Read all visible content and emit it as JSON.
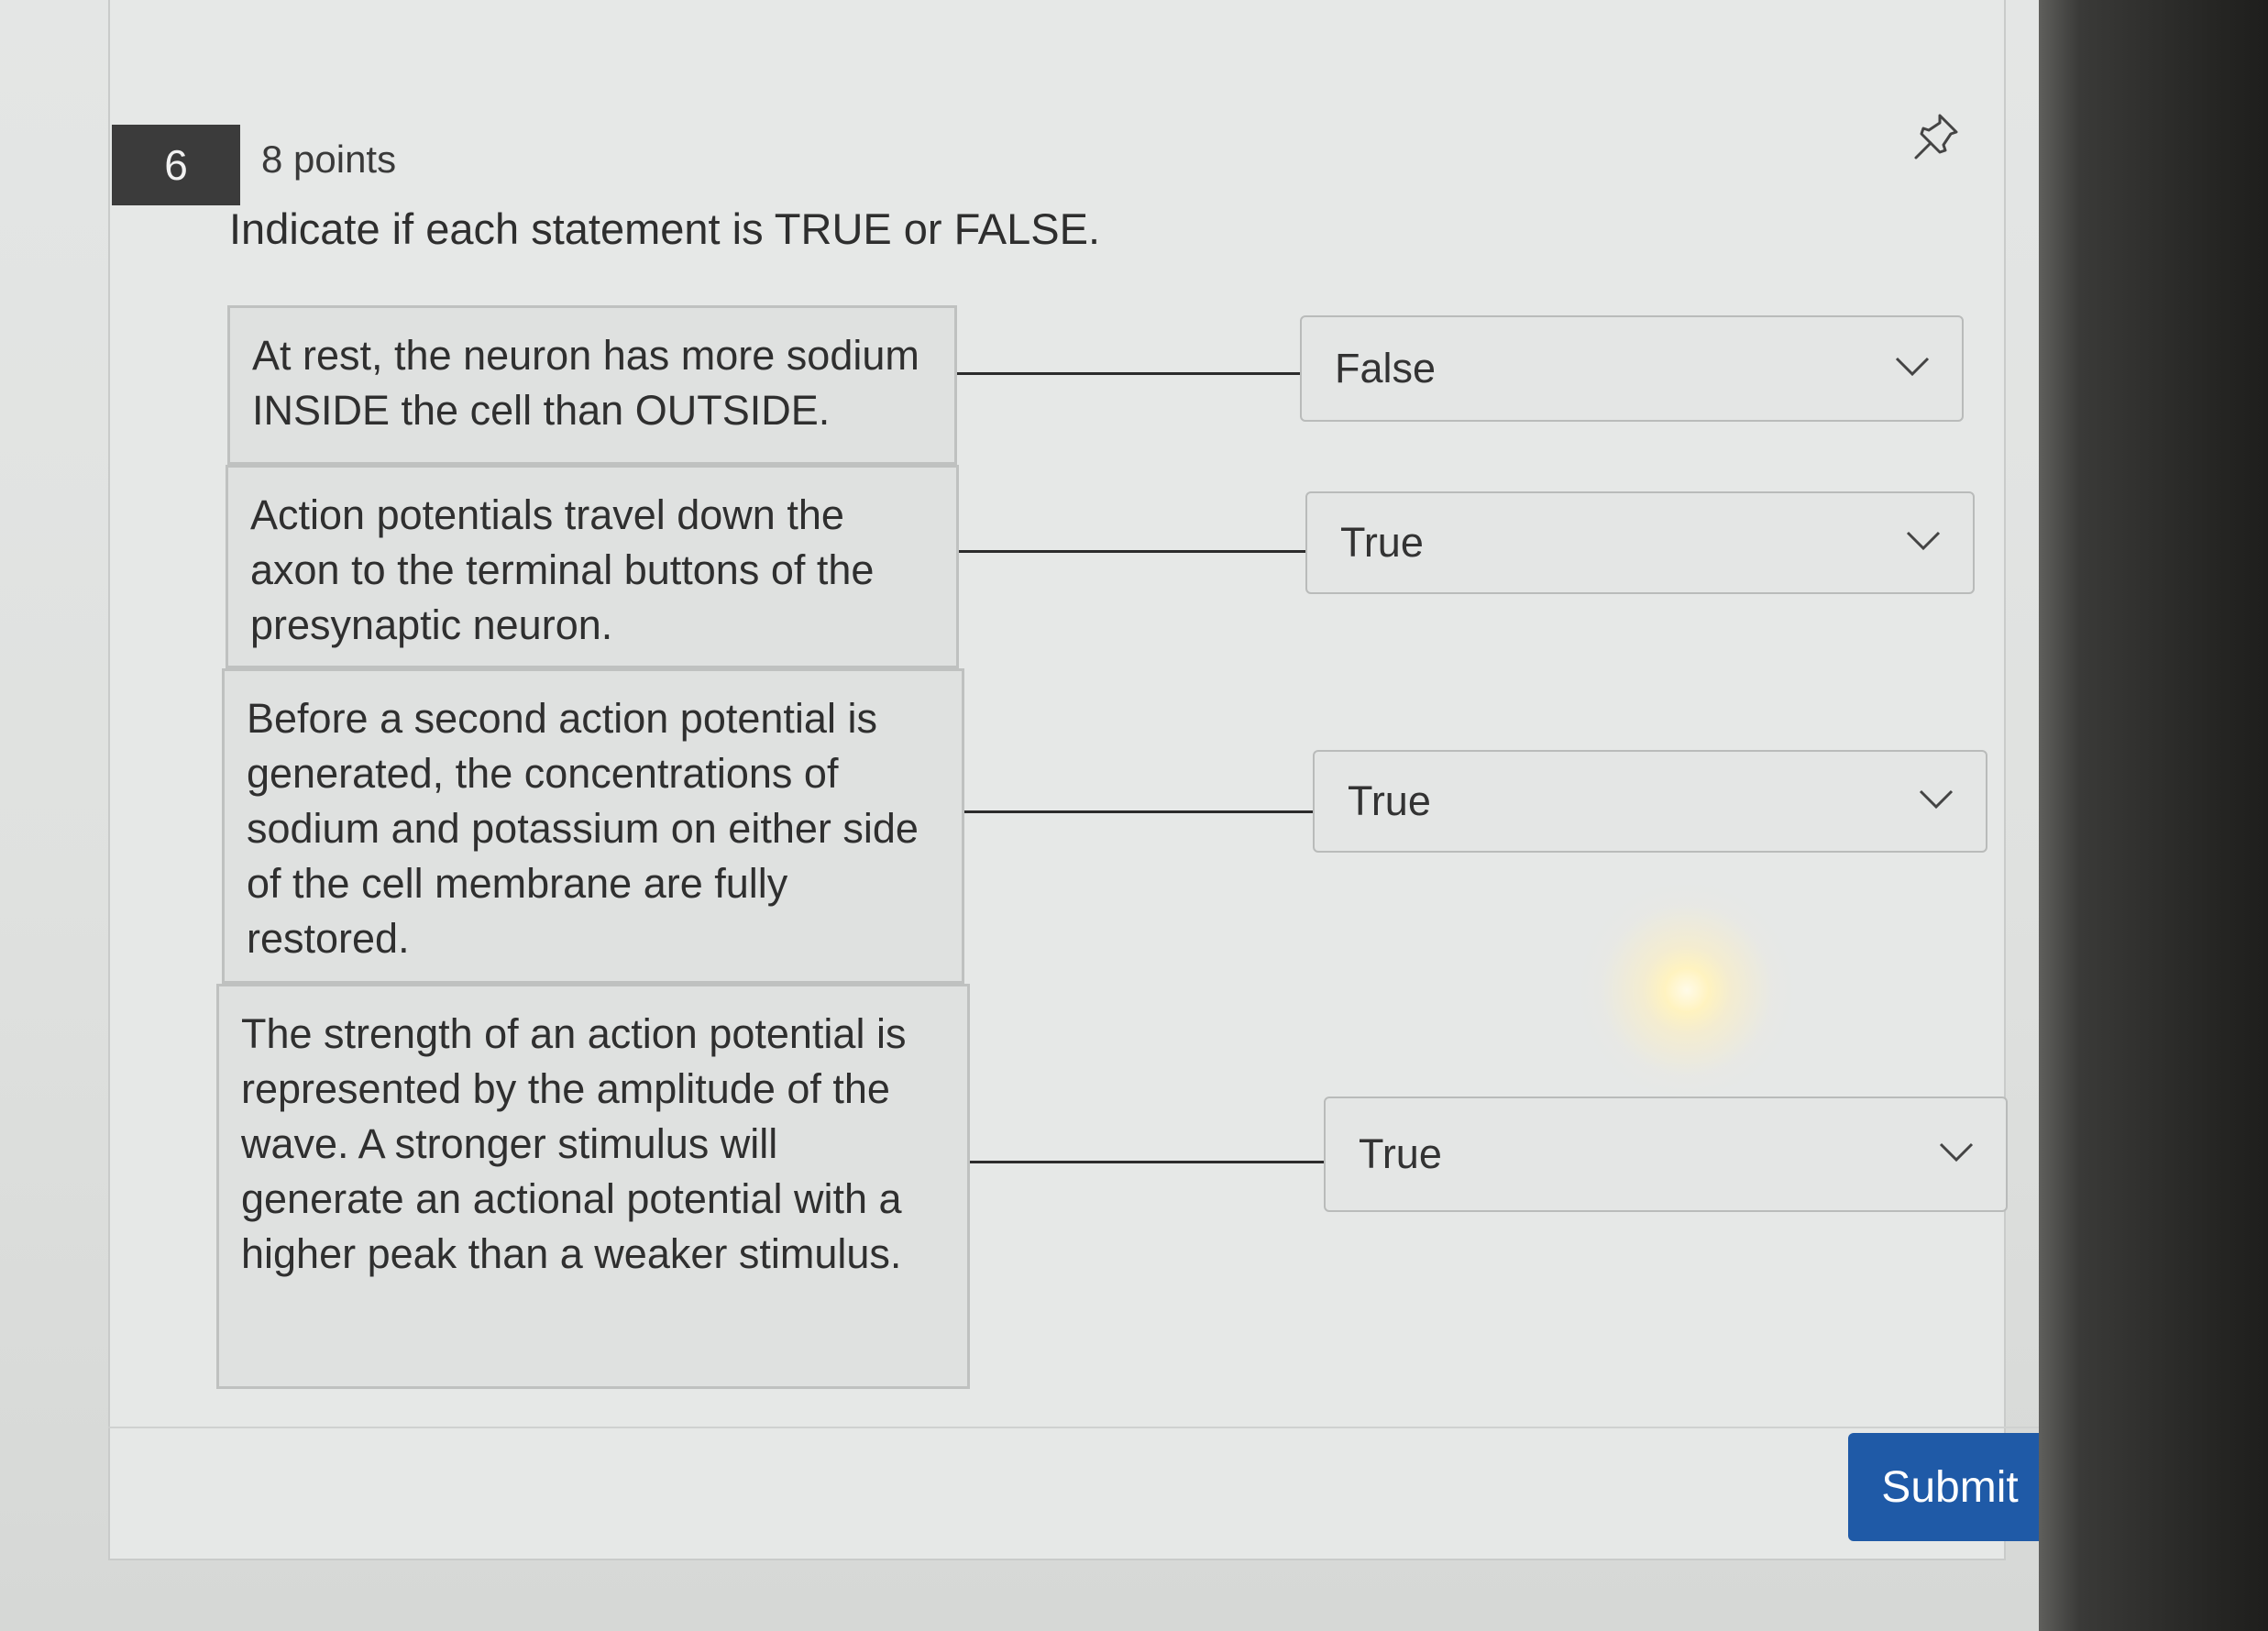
{
  "question": {
    "number": "6",
    "points": "8 points",
    "prompt": "Indicate if each statement is TRUE or FALSE."
  },
  "statements": [
    {
      "text": "At rest, the neuron has more sodium INSIDE the cell than OUTSIDE.",
      "answer": "False"
    },
    {
      "text": "Action potentials travel down the axon to the terminal buttons of the presynaptic neuron.",
      "answer": "True"
    },
    {
      "text": "Before a second action potential is generated, the concentrations of sodium and potassium on either side of the cell membrane are fully restored.",
      "answer": "True"
    },
    {
      "text": "The strength of an action potential is represented by the amplitude of the wave. A stronger stimulus will generate an actional potential with a higher peak than a weaker stimulus.",
      "answer": "True"
    }
  ],
  "submit_label": "Submit",
  "icons": {
    "pin": "pin-icon",
    "dropdown": "chevron-down-icon"
  },
  "colors": {
    "submit": "#1f5aa7",
    "number_badge": "#3b3b3b"
  }
}
